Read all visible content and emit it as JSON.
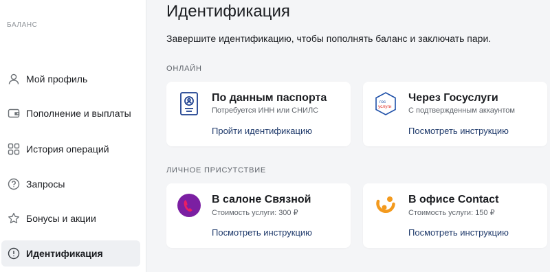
{
  "sidebar": {
    "section_title": "БАЛАНС",
    "items": [
      {
        "label": "Мой профиль",
        "icon": "person-icon"
      },
      {
        "label": "Пополнение и выплаты",
        "icon": "wallet-icon"
      },
      {
        "label": "История операций",
        "icon": "grid-icon"
      },
      {
        "label": "Запросы",
        "icon": "question-icon"
      },
      {
        "label": "Бонусы и акции",
        "icon": "star-icon"
      },
      {
        "label": "Идентификация",
        "icon": "info-icon",
        "active": true
      }
    ]
  },
  "main": {
    "title": "Идентификация",
    "description": "Завершите идентификацию, чтобы пополнять баланс и заключать пари.",
    "sections": [
      {
        "label": "ОНЛАЙН",
        "cards": [
          {
            "title": "По данным паспорта",
            "subtitle": "Потребуется ИНН или СНИЛС",
            "link": "Пройти идентификацию",
            "icon": "passport-icon"
          },
          {
            "title": "Через Госуслуги",
            "subtitle": "С подтвержденным аккаунтом",
            "link": "Посмотреть инструкцию",
            "icon": "gosuslugi-icon",
            "icon_text": [
              "гос",
              "услуги"
            ]
          }
        ]
      },
      {
        "label": "ЛИЧНОЕ ПРИСУТСТВИЕ",
        "cards": [
          {
            "title": "В салоне Связной",
            "subtitle": "Стоимость услуги: 300 ₽",
            "link": "Посмотреть инструкцию",
            "icon": "svyaznoy-icon"
          },
          {
            "title": "В офисе Contact",
            "subtitle": "Стоимость услуги: 150 ₽",
            "link": "Посмотреть инструкцию",
            "icon": "contact-icon"
          }
        ]
      }
    ]
  },
  "colors": {
    "accent_link": "#1f3a6b",
    "passport_blue": "#1d3f8f",
    "gosuslugi_blue": "#1d4fa8",
    "gosuslugi_red": "#e2342b",
    "svyaznoy_purple": "#7b1fa2",
    "svyaznoy_pink": "#e91e63",
    "contact_orange": "#f39a1e"
  }
}
